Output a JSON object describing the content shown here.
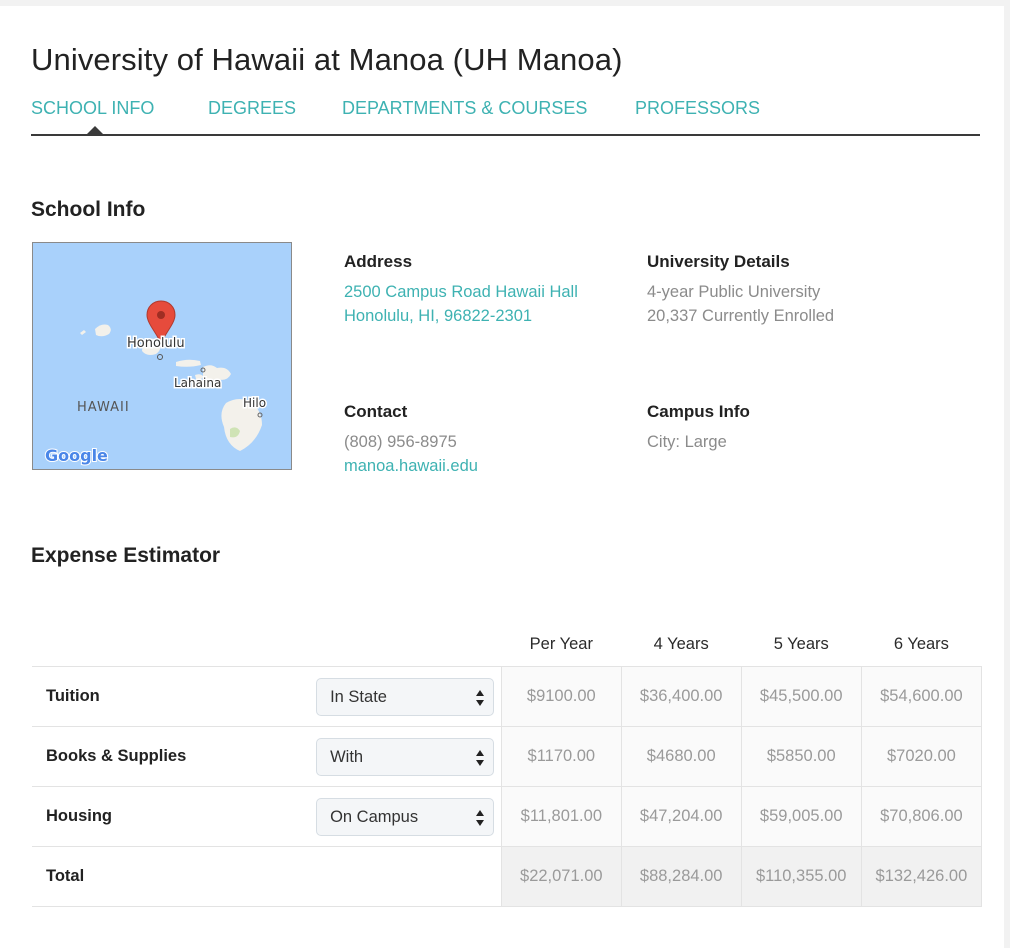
{
  "page": {
    "title": "University of Hawaii at Manoa (UH Manoa)"
  },
  "tabs": [
    {
      "label": "SCHOOL INFO",
      "active": true
    },
    {
      "label": "DEGREES"
    },
    {
      "label": "DEPARTMENTS & COURSES"
    },
    {
      "label": "PROFESSORS"
    }
  ],
  "school_info": {
    "heading": "School Info",
    "map": {
      "labels": [
        "Honolulu",
        "Lahaina",
        "HAWAII",
        "Hilo"
      ],
      "google_logo": "Google",
      "water_color": "#a9d1fb",
      "marker_color": "#e64b3c"
    },
    "address": {
      "label": "Address",
      "line1": "2500 Campus Road Hawaii Hall",
      "line2": "Honolulu, HI, 96822-2301"
    },
    "university_details": {
      "label": "University Details",
      "line1": "4-year Public University",
      "line2": "20,337 Currently Enrolled"
    },
    "contact": {
      "label": "Contact",
      "phone": "(808) 956-8975",
      "website": "manoa.hawaii.edu"
    },
    "campus_info": {
      "label": "Campus Info",
      "line1": "City: Large"
    }
  },
  "expense": {
    "heading": "Expense Estimator",
    "columns": [
      "Per Year",
      "4 Years",
      "5 Years",
      "6 Years"
    ],
    "rows": [
      {
        "label": "Tuition",
        "select": "In State",
        "values": [
          "$9100.00",
          "$36,400.00",
          "$45,500.00",
          "$54,600.00"
        ]
      },
      {
        "label": "Books & Supplies",
        "select": "With",
        "values": [
          "$1170.00",
          "$4680.00",
          "$5850.00",
          "$7020.00"
        ]
      },
      {
        "label": "Housing",
        "select": "On Campus",
        "values": [
          "$11,801.00",
          "$47,204.00",
          "$59,005.00",
          "$70,806.00"
        ]
      }
    ],
    "total": {
      "label": "Total",
      "values": [
        "$22,071.00",
        "$88,284.00",
        "$110,355.00",
        "$132,426.00"
      ]
    }
  },
  "colors": {
    "accent": "#3eb2b2",
    "muted_text": "#8b8b8b"
  }
}
